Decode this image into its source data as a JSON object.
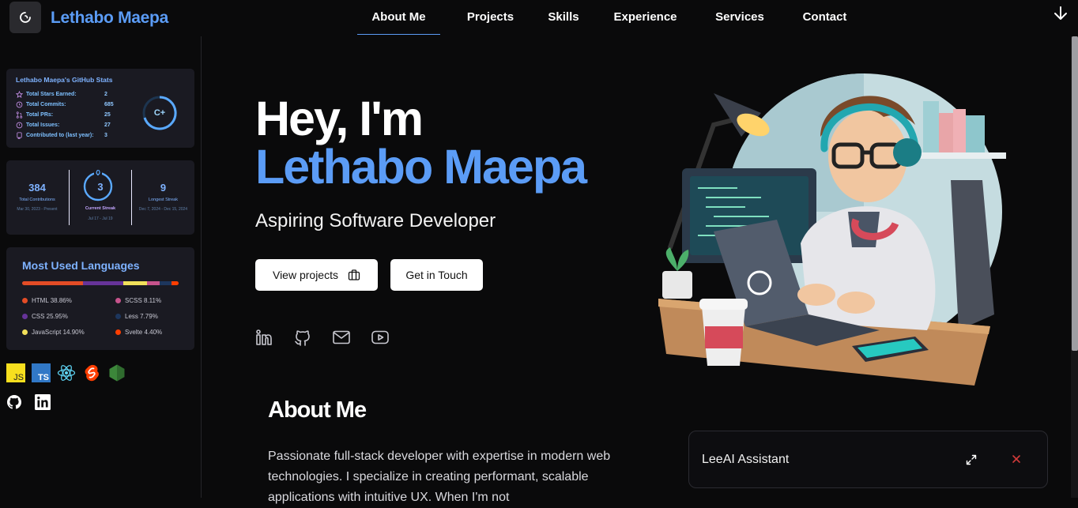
{
  "brand": {
    "name": "Lethabo Maepa"
  },
  "nav": [
    "About Me",
    "Projects",
    "Skills",
    "Experience",
    "Services",
    "Contact"
  ],
  "nav_active": "About Me",
  "github_stats": {
    "title": "Lethabo Maepa's GitHub Stats",
    "rows": [
      {
        "label": "Total Stars Earned:",
        "value": "2",
        "icon": "star-icon"
      },
      {
        "label": "Total Commits:",
        "value": "685",
        "icon": "clock-icon"
      },
      {
        "label": "Total PRs:",
        "value": "25",
        "icon": "pull-request-icon"
      },
      {
        "label": "Total Issues:",
        "value": "27",
        "icon": "issue-icon"
      },
      {
        "label": "Contributed to (last year):",
        "value": "3",
        "icon": "repo-icon"
      }
    ],
    "grade": "C+"
  },
  "streak": {
    "total": {
      "value": "384",
      "label": "Total Contributions",
      "range": "Mar 30, 2023 - Present"
    },
    "current": {
      "value": "3",
      "label": "Current Streak",
      "range": "Jul 17 - Jul 19"
    },
    "longest": {
      "value": "9",
      "label": "Longest Streak",
      "range": "Dec 7, 2024 - Dec 15, 2024"
    }
  },
  "languages": {
    "title": "Most Used Languages",
    "items": [
      {
        "name": "HTML 38.86%",
        "color": "#e34c26",
        "percent": 38.86
      },
      {
        "name": "CSS 25.95%",
        "color": "#663399",
        "percent": 25.95
      },
      {
        "name": "JavaScript 14.90%",
        "color": "#f1e05a",
        "percent": 14.9
      },
      {
        "name": "SCSS 8.11%",
        "color": "#c6538c",
        "percent": 8.11
      },
      {
        "name": "Less 7.79%",
        "color": "#1d365d",
        "percent": 7.79
      },
      {
        "name": "Svelte 4.40%",
        "color": "#ff3e00",
        "percent": 4.4
      }
    ]
  },
  "tech_icons": [
    "javascript-icon",
    "typescript-icon",
    "react-icon",
    "svelte-icon",
    "nodejs-icon"
  ],
  "hero": {
    "greeting": "Hey, I'm",
    "name": "Lethabo Maepa",
    "subtitle": "Aspiring Software Developer",
    "btn_projects": "View projects",
    "btn_contact": "Get in Touch"
  },
  "about": {
    "title": "About Me",
    "text": "Passionate full-stack developer with expertise in modern web technologies. I specialize in creating performant, scalable applications with intuitive UX. When I'm not"
  },
  "assistant": {
    "title": "LeeAI Assistant"
  }
}
